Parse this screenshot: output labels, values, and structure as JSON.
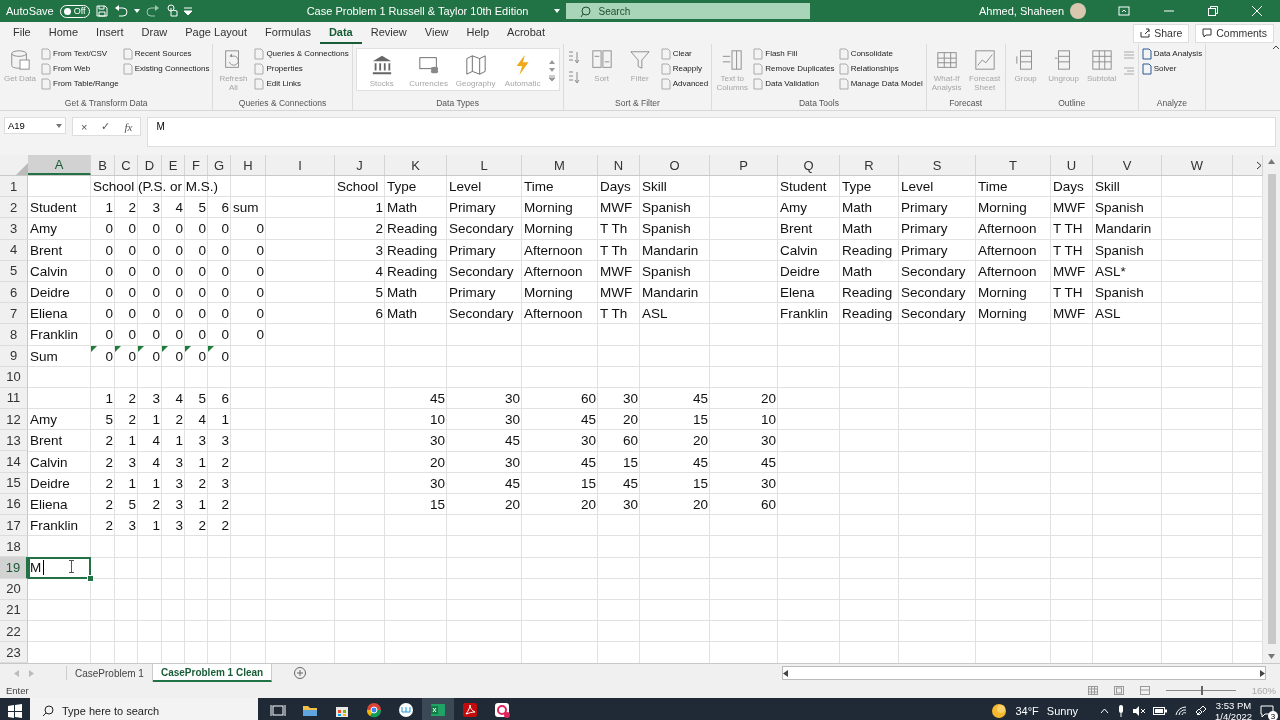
{
  "title_bar": {
    "autosave_label": "AutoSave",
    "autosave_state": "Off",
    "autosave_on": false,
    "title": "Case Problem 1 Russell & Taylor 10th Edition",
    "search": {
      "placeholder": "Search"
    },
    "user": "Ahmed, Shaheen"
  },
  "menu": {
    "tabs": [
      {
        "label": "File",
        "selected": false
      },
      {
        "label": "Home",
        "selected": false
      },
      {
        "label": "Insert",
        "selected": false
      },
      {
        "label": "Draw",
        "selected": false
      },
      {
        "label": "Page Layout",
        "selected": false
      },
      {
        "label": "Formulas",
        "selected": false
      },
      {
        "label": "Data",
        "selected": true
      },
      {
        "label": "Review",
        "selected": false
      },
      {
        "label": "View",
        "selected": false
      },
      {
        "label": "Help",
        "selected": false
      },
      {
        "label": "Acrobat",
        "selected": false
      }
    ],
    "share": "Share",
    "comments": "Comments"
  },
  "ribbon": [
    {
      "kind": "standard",
      "label": "Get & Transform Data",
      "large": [
        {
          "label": "Get Data",
          "disabled": true
        }
      ],
      "small": [
        {
          "label": "From Text/CSV",
          "disabled": true
        },
        {
          "label": "From Web",
          "disabled": true
        },
        {
          "label": "From Table/Range",
          "disabled": true
        },
        {
          "label": "Recent Sources",
          "disabled": true
        },
        {
          "label": "Existing Connections",
          "disabled": true
        }
      ]
    },
    {
      "kind": "standard",
      "label": "Queries & Connections",
      "large": [
        {
          "label": "Refresh All",
          "disabled": true
        }
      ],
      "small": [
        {
          "label": "Queries & Connections",
          "disabled": true
        },
        {
          "label": "Properties",
          "disabled": true
        },
        {
          "label": "Edit Links",
          "disabled": true
        }
      ]
    },
    {
      "kind": "gallery",
      "label": "Data Types",
      "large": [
        {
          "label": "Stocks",
          "disabled": true
        },
        {
          "label": "Currencies",
          "disabled": true
        },
        {
          "label": "Geography",
          "disabled": true
        },
        {
          "label": "Automatic",
          "disabled": true
        }
      ]
    },
    {
      "kind": "sort",
      "label": "Sort & Filter",
      "large": [
        {
          "label": "Sort",
          "disabled": true
        },
        {
          "label": "Filter",
          "disabled": true
        }
      ],
      "small": [
        {
          "label": "Clear",
          "disabled": true
        },
        {
          "label": "Reapply",
          "disabled": true
        },
        {
          "label": "Advanced",
          "disabled": true
        }
      ]
    },
    {
      "kind": "standard",
      "label": "Data Tools",
      "large": [
        {
          "label": "Text to Columns",
          "disabled": true
        }
      ],
      "small": [
        {
          "label": "Flash Fill",
          "disabled": true
        },
        {
          "label": "Remove Duplicates",
          "disabled": true
        },
        {
          "label": "Data Validation",
          "disabled": true
        },
        {
          "label": "Consolidate",
          "disabled": true
        },
        {
          "label": "Relationships",
          "disabled": true
        },
        {
          "label": "Manage Data Model",
          "disabled": true
        }
      ]
    },
    {
      "kind": "standard",
      "label": "Forecast",
      "large": [
        {
          "label": "What-If Analysis",
          "disabled": true
        },
        {
          "label": "Forecast Sheet",
          "disabled": true
        }
      ]
    },
    {
      "kind": "outline",
      "label": "Outline",
      "large": [
        {
          "label": "Group",
          "disabled": true
        },
        {
          "label": "Ungroup",
          "disabled": true
        },
        {
          "label": "Subtotal",
          "disabled": true
        }
      ]
    },
    {
      "kind": "standard",
      "label": "Analyze",
      "small": [
        {
          "label": "Data Analysis",
          "disabled": false
        },
        {
          "label": "Solver",
          "disabled": false
        }
      ]
    }
  ],
  "formula_bar": {
    "name_box": "A19",
    "cancel": "×",
    "enter": "✓",
    "function": "fx",
    "value": "M"
  },
  "columns": [
    {
      "label": "A",
      "selected": true
    },
    {
      "label": "B",
      "selected": false
    },
    {
      "label": "C",
      "selected": false
    },
    {
      "label": "D",
      "selected": false
    },
    {
      "label": "E",
      "selected": false
    },
    {
      "label": "F",
      "selected": false
    },
    {
      "label": "G",
      "selected": false
    },
    {
      "label": "H",
      "selected": false
    },
    {
      "label": "I",
      "selected": false
    },
    {
      "label": "J",
      "selected": false
    },
    {
      "label": "K",
      "selected": false
    },
    {
      "label": "L",
      "selected": false
    },
    {
      "label": "M",
      "selected": false
    },
    {
      "label": "N",
      "selected": false
    },
    {
      "label": "O",
      "selected": false
    },
    {
      "label": "P",
      "selected": false
    },
    {
      "label": "Q",
      "selected": false
    },
    {
      "label": "R",
      "selected": false
    },
    {
      "label": "S",
      "selected": false
    },
    {
      "label": "T",
      "selected": false
    },
    {
      "label": "U",
      "selected": false
    },
    {
      "label": "V",
      "selected": false
    },
    {
      "label": "W",
      "selected": false
    }
  ],
  "rows": [
    {
      "number": "1",
      "selected": false,
      "cells": {
        "B": {
          "text": "School (P.S. or M.S.)",
          "kind": "text"
        },
        "J": {
          "text": "School",
          "kind": "text"
        },
        "K": {
          "text": "Type",
          "kind": "text"
        },
        "L": {
          "text": "Level",
          "kind": "text"
        },
        "M": {
          "text": "Time",
          "kind": "text"
        },
        "N": {
          "text": "Days",
          "kind": "text"
        },
        "O": {
          "text": "Skill",
          "kind": "text"
        },
        "Q": {
          "text": "Student",
          "kind": "text"
        },
        "R": {
          "text": "Type",
          "kind": "text"
        },
        "S": {
          "text": "Level",
          "kind": "text"
        },
        "T": {
          "text": "Time",
          "kind": "text"
        },
        "U": {
          "text": "Days",
          "kind": "text"
        },
        "V": {
          "text": "Skill",
          "kind": "text"
        }
      }
    },
    {
      "number": "2",
      "selected": false,
      "cells": {
        "A": {
          "text": "Student",
          "kind": "text"
        },
        "B": {
          "text": "1",
          "kind": "number"
        },
        "C": {
          "text": "2",
          "kind": "number"
        },
        "D": {
          "text": "3",
          "kind": "number"
        },
        "E": {
          "text": "4",
          "kind": "number"
        },
        "F": {
          "text": "5",
          "kind": "number"
        },
        "G": {
          "text": "6",
          "kind": "number"
        },
        "H": {
          "text": "sum",
          "kind": "text"
        },
        "J": {
          "text": "1",
          "kind": "number"
        },
        "K": {
          "text": "Math",
          "kind": "text"
        },
        "L": {
          "text": "Primary",
          "kind": "text"
        },
        "M": {
          "text": "Morning",
          "kind": "text"
        },
        "N": {
          "text": "MWF",
          "kind": "text"
        },
        "O": {
          "text": "Spanish",
          "kind": "text"
        },
        "Q": {
          "text": "Amy",
          "kind": "text"
        },
        "R": {
          "text": "Math",
          "kind": "text"
        },
        "S": {
          "text": "Primary",
          "kind": "text"
        },
        "T": {
          "text": "Morning",
          "kind": "text"
        },
        "U": {
          "text": "MWF",
          "kind": "text"
        },
        "V": {
          "text": "Spanish",
          "kind": "text"
        }
      }
    },
    {
      "number": "3",
      "selected": false,
      "cells": {
        "A": {
          "text": "Amy",
          "kind": "text"
        },
        "B": {
          "text": "0",
          "kind": "number"
        },
        "C": {
          "text": "0",
          "kind": "number"
        },
        "D": {
          "text": "0",
          "kind": "number"
        },
        "E": {
          "text": "0",
          "kind": "number"
        },
        "F": {
          "text": "0",
          "kind": "number"
        },
        "G": {
          "text": "0",
          "kind": "number"
        },
        "H": {
          "text": "0",
          "kind": "number"
        },
        "J": {
          "text": "2",
          "kind": "number"
        },
        "K": {
          "text": "Reading",
          "kind": "text"
        },
        "L": {
          "text": "Secondary",
          "kind": "text"
        },
        "M": {
          "text": "Morning",
          "kind": "text"
        },
        "N": {
          "text": "T Th",
          "kind": "text"
        },
        "O": {
          "text": "Spanish",
          "kind": "text"
        },
        "Q": {
          "text": "Brent",
          "kind": "text"
        },
        "R": {
          "text": "Math",
          "kind": "text"
        },
        "S": {
          "text": "Primary",
          "kind": "text"
        },
        "T": {
          "text": "Afternoon",
          "kind": "text"
        },
        "U": {
          "text": "T TH",
          "kind": "text"
        },
        "V": {
          "text": "Mandarin",
          "kind": "text"
        }
      }
    },
    {
      "number": "4",
      "selected": false,
      "cells": {
        "A": {
          "text": "Brent",
          "kind": "text"
        },
        "B": {
          "text": "0",
          "kind": "number"
        },
        "C": {
          "text": "0",
          "kind": "number"
        },
        "D": {
          "text": "0",
          "kind": "number"
        },
        "E": {
          "text": "0",
          "kind": "number"
        },
        "F": {
          "text": "0",
          "kind": "number"
        },
        "G": {
          "text": "0",
          "kind": "number"
        },
        "H": {
          "text": "0",
          "kind": "number"
        },
        "J": {
          "text": "3",
          "kind": "number"
        },
        "K": {
          "text": "Reading",
          "kind": "text"
        },
        "L": {
          "text": "Primary",
          "kind": "text"
        },
        "M": {
          "text": "Afternoon",
          "kind": "text"
        },
        "N": {
          "text": "T Th",
          "kind": "text"
        },
        "O": {
          "text": "Mandarin",
          "kind": "text"
        },
        "Q": {
          "text": "Calvin",
          "kind": "text"
        },
        "R": {
          "text": "Reading",
          "kind": "text"
        },
        "S": {
          "text": "Primary",
          "kind": "text"
        },
        "T": {
          "text": "Afternoon",
          "kind": "text"
        },
        "U": {
          "text": "T TH",
          "kind": "text"
        },
        "V": {
          "text": "Spanish",
          "kind": "text"
        }
      }
    },
    {
      "number": "5",
      "selected": false,
      "cells": {
        "A": {
          "text": "Calvin",
          "kind": "text"
        },
        "B": {
          "text": "0",
          "kind": "number"
        },
        "C": {
          "text": "0",
          "kind": "number"
        },
        "D": {
          "text": "0",
          "kind": "number"
        },
        "E": {
          "text": "0",
          "kind": "number"
        },
        "F": {
          "text": "0",
          "kind": "number"
        },
        "G": {
          "text": "0",
          "kind": "number"
        },
        "H": {
          "text": "0",
          "kind": "number"
        },
        "J": {
          "text": "4",
          "kind": "number"
        },
        "K": {
          "text": "Reading",
          "kind": "text"
        },
        "L": {
          "text": "Secondary",
          "kind": "text"
        },
        "M": {
          "text": "Afternoon",
          "kind": "text"
        },
        "N": {
          "text": "MWF",
          "kind": "text"
        },
        "O": {
          "text": "Spanish",
          "kind": "text"
        },
        "Q": {
          "text": "Deidre",
          "kind": "text"
        },
        "R": {
          "text": "Math",
          "kind": "text"
        },
        "S": {
          "text": "Secondary",
          "kind": "text"
        },
        "T": {
          "text": "Afternoon",
          "kind": "text"
        },
        "U": {
          "text": "MWF",
          "kind": "text"
        },
        "V": {
          "text": "ASL*",
          "kind": "text"
        }
      }
    },
    {
      "number": "6",
      "selected": false,
      "cells": {
        "A": {
          "text": "Deidre",
          "kind": "text"
        },
        "B": {
          "text": "0",
          "kind": "number"
        },
        "C": {
          "text": "0",
          "kind": "number"
        },
        "D": {
          "text": "0",
          "kind": "number"
        },
        "E": {
          "text": "0",
          "kind": "number"
        },
        "F": {
          "text": "0",
          "kind": "number"
        },
        "G": {
          "text": "0",
          "kind": "number"
        },
        "H": {
          "text": "0",
          "kind": "number"
        },
        "J": {
          "text": "5",
          "kind": "number"
        },
        "K": {
          "text": "Math",
          "kind": "text"
        },
        "L": {
          "text": "Primary",
          "kind": "text"
        },
        "M": {
          "text": "Morning",
          "kind": "text"
        },
        "N": {
          "text": "MWF",
          "kind": "text"
        },
        "O": {
          "text": "Mandarin",
          "kind": "text"
        },
        "Q": {
          "text": "Elena",
          "kind": "text"
        },
        "R": {
          "text": "Reading",
          "kind": "text"
        },
        "S": {
          "text": "Secondary",
          "kind": "text"
        },
        "T": {
          "text": "Morning",
          "kind": "text"
        },
        "U": {
          "text": "T TH",
          "kind": "text"
        },
        "V": {
          "text": "Spanish",
          "kind": "text"
        }
      }
    },
    {
      "number": "7",
      "selected": false,
      "cells": {
        "A": {
          "text": "Eliena",
          "kind": "text"
        },
        "B": {
          "text": "0",
          "kind": "number"
        },
        "C": {
          "text": "0",
          "kind": "number"
        },
        "D": {
          "text": "0",
          "kind": "number"
        },
        "E": {
          "text": "0",
          "kind": "number"
        },
        "F": {
          "text": "0",
          "kind": "number"
        },
        "G": {
          "text": "0",
          "kind": "number"
        },
        "H": {
          "text": "0",
          "kind": "number"
        },
        "J": {
          "text": "6",
          "kind": "number"
        },
        "K": {
          "text": "Math",
          "kind": "text"
        },
        "L": {
          "text": "Secondary",
          "kind": "text"
        },
        "M": {
          "text": "Afternoon",
          "kind": "text"
        },
        "N": {
          "text": "T Th",
          "kind": "text"
        },
        "O": {
          "text": "ASL",
          "kind": "text"
        },
        "Q": {
          "text": "Franklin",
          "kind": "text"
        },
        "R": {
          "text": "Reading",
          "kind": "text"
        },
        "S": {
          "text": "Secondary",
          "kind": "text"
        },
        "T": {
          "text": "Morning",
          "kind": "text"
        },
        "U": {
          "text": "MWF",
          "kind": "text"
        },
        "V": {
          "text": "ASL",
          "kind": "text"
        }
      }
    },
    {
      "number": "8",
      "selected": false,
      "cells": {
        "A": {
          "text": "Franklin",
          "kind": "text"
        },
        "B": {
          "text": "0",
          "kind": "number"
        },
        "C": {
          "text": "0",
          "kind": "number"
        },
        "D": {
          "text": "0",
          "kind": "number"
        },
        "E": {
          "text": "0",
          "kind": "number"
        },
        "F": {
          "text": "0",
          "kind": "number"
        },
        "G": {
          "text": "0",
          "kind": "number"
        },
        "H": {
          "text": "0",
          "kind": "number"
        }
      }
    },
    {
      "number": "9",
      "selected": false,
      "cells": {
        "A": {
          "text": "Sum",
          "kind": "text"
        },
        "B": {
          "text": "0",
          "kind": "number",
          "flag": true
        },
        "C": {
          "text": "0",
          "kind": "number",
          "flag": true
        },
        "D": {
          "text": "0",
          "kind": "number",
          "flag": true
        },
        "E": {
          "text": "0",
          "kind": "number",
          "flag": true
        },
        "F": {
          "text": "0",
          "kind": "number",
          "flag": true
        },
        "G": {
          "text": "0",
          "kind": "number",
          "flag": true
        }
      }
    },
    {
      "number": "10",
      "selected": false
    },
    {
      "number": "11",
      "selected": false,
      "cells": {
        "B": {
          "text": "1",
          "kind": "number"
        },
        "C": {
          "text": "2",
          "kind": "number"
        },
        "D": {
          "text": "3",
          "kind": "number"
        },
        "E": {
          "text": "4",
          "kind": "number"
        },
        "F": {
          "text": "5",
          "kind": "number"
        },
        "G": {
          "text": "6",
          "kind": "number"
        },
        "K": {
          "text": "45",
          "kind": "number"
        },
        "L": {
          "text": "30",
          "kind": "number"
        },
        "M": {
          "text": "60",
          "kind": "number"
        },
        "N": {
          "text": "30",
          "kind": "number"
        },
        "O": {
          "text": "45",
          "kind": "number"
        },
        "P": {
          "text": "20",
          "kind": "number"
        }
      }
    },
    {
      "number": "12",
      "selected": false,
      "cells": {
        "A": {
          "text": "Amy",
          "kind": "text"
        },
        "B": {
          "text": "5",
          "kind": "number"
        },
        "C": {
          "text": "2",
          "kind": "number"
        },
        "D": {
          "text": "1",
          "kind": "number"
        },
        "E": {
          "text": "2",
          "kind": "number"
        },
        "F": {
          "text": "4",
          "kind": "number"
        },
        "G": {
          "text": "1",
          "kind": "number"
        },
        "K": {
          "text": "10",
          "kind": "number"
        },
        "L": {
          "text": "30",
          "kind": "number"
        },
        "M": {
          "text": "45",
          "kind": "number"
        },
        "N": {
          "text": "20",
          "kind": "number"
        },
        "O": {
          "text": "15",
          "kind": "number"
        },
        "P": {
          "text": "10",
          "kind": "number"
        }
      }
    },
    {
      "number": "13",
      "selected": false,
      "cells": {
        "A": {
          "text": "Brent",
          "kind": "text"
        },
        "B": {
          "text": "2",
          "kind": "number"
        },
        "C": {
          "text": "1",
          "kind": "number"
        },
        "D": {
          "text": "4",
          "kind": "number"
        },
        "E": {
          "text": "1",
          "kind": "number"
        },
        "F": {
          "text": "3",
          "kind": "number"
        },
        "G": {
          "text": "3",
          "kind": "number"
        },
        "K": {
          "text": "30",
          "kind": "number"
        },
        "L": {
          "text": "45",
          "kind": "number"
        },
        "M": {
          "text": "30",
          "kind": "number"
        },
        "N": {
          "text": "60",
          "kind": "number"
        },
        "O": {
          "text": "20",
          "kind": "number"
        },
        "P": {
          "text": "30",
          "kind": "number"
        }
      }
    },
    {
      "number": "14",
      "selected": false,
      "cells": {
        "A": {
          "text": "Calvin",
          "kind": "text"
        },
        "B": {
          "text": "2",
          "kind": "number"
        },
        "C": {
          "text": "3",
          "kind": "number"
        },
        "D": {
          "text": "4",
          "kind": "number"
        },
        "E": {
          "text": "3",
          "kind": "number"
        },
        "F": {
          "text": "1",
          "kind": "number"
        },
        "G": {
          "text": "2",
          "kind": "number"
        },
        "K": {
          "text": "20",
          "kind": "number"
        },
        "L": {
          "text": "30",
          "kind": "number"
        },
        "M": {
          "text": "45",
          "kind": "number"
        },
        "N": {
          "text": "15",
          "kind": "number"
        },
        "O": {
          "text": "45",
          "kind": "number"
        },
        "P": {
          "text": "45",
          "kind": "number"
        }
      }
    },
    {
      "number": "15",
      "selected": false,
      "cells": {
        "A": {
          "text": "Deidre",
          "kind": "text"
        },
        "B": {
          "text": "2",
          "kind": "number"
        },
        "C": {
          "text": "1",
          "kind": "number"
        },
        "D": {
          "text": "1",
          "kind": "number"
        },
        "E": {
          "text": "3",
          "kind": "number"
        },
        "F": {
          "text": "2",
          "kind": "number"
        },
        "G": {
          "text": "3",
          "kind": "number"
        },
        "K": {
          "text": "30",
          "kind": "number"
        },
        "L": {
          "text": "45",
          "kind": "number"
        },
        "M": {
          "text": "15",
          "kind": "number"
        },
        "N": {
          "text": "45",
          "kind": "number"
        },
        "O": {
          "text": "15",
          "kind": "number"
        },
        "P": {
          "text": "30",
          "kind": "number"
        }
      }
    },
    {
      "number": "16",
      "selected": false,
      "cells": {
        "A": {
          "text": "Eliena",
          "kind": "text"
        },
        "B": {
          "text": "2",
          "kind": "number"
        },
        "C": {
          "text": "5",
          "kind": "number"
        },
        "D": {
          "text": "2",
          "kind": "number"
        },
        "E": {
          "text": "3",
          "kind": "number"
        },
        "F": {
          "text": "1",
          "kind": "number"
        },
        "G": {
          "text": "2",
          "kind": "number"
        },
        "K": {
          "text": "15",
          "kind": "number"
        },
        "L": {
          "text": "20",
          "kind": "number"
        },
        "M": {
          "text": "20",
          "kind": "number"
        },
        "N": {
          "text": "30",
          "kind": "number"
        },
        "O": {
          "text": "20",
          "kind": "number"
        },
        "P": {
          "text": "60",
          "kind": "number"
        }
      }
    },
    {
      "number": "17",
      "selected": false,
      "cells": {
        "A": {
          "text": "Franklin",
          "kind": "text"
        },
        "B": {
          "text": "2",
          "kind": "number"
        },
        "C": {
          "text": "3",
          "kind": "number"
        },
        "D": {
          "text": "1",
          "kind": "number"
        },
        "E": {
          "text": "3",
          "kind": "number"
        },
        "F": {
          "text": "2",
          "kind": "number"
        },
        "G": {
          "text": "2",
          "kind": "number"
        }
      }
    },
    {
      "number": "18",
      "selected": false
    },
    {
      "number": "19",
      "selected": true,
      "cells": {
        "A": {
          "text": "M",
          "kind": "text",
          "editing": true
        }
      }
    },
    {
      "number": "20",
      "selected": false
    },
    {
      "number": "21",
      "selected": false
    },
    {
      "number": "22",
      "selected": false
    },
    {
      "number": "23",
      "selected": false
    }
  ],
  "sheet_tabs": [
    {
      "label": "CaseProblem 1",
      "selected": false
    },
    {
      "label": "CaseProblem 1 Clean",
      "selected": true
    }
  ],
  "status_bar": {
    "mode": "Enter",
    "zoom": "160%",
    "zoom_level": {
      "level": 0.5
    }
  },
  "taskbar": {
    "search": {
      "placeholder": "Type here to search"
    },
    "apps": [
      {
        "selected": false
      },
      {
        "selected": false
      },
      {
        "selected": false
      },
      {
        "selected": false
      },
      {
        "selected": false
      },
      {
        "selected": true
      },
      {
        "selected": false
      },
      {
        "selected": false
      }
    ],
    "temperature": "34°F",
    "weather": "Sunny",
    "time": "3:53 PM",
    "date": "1/4/2022",
    "notifications": "3"
  }
}
